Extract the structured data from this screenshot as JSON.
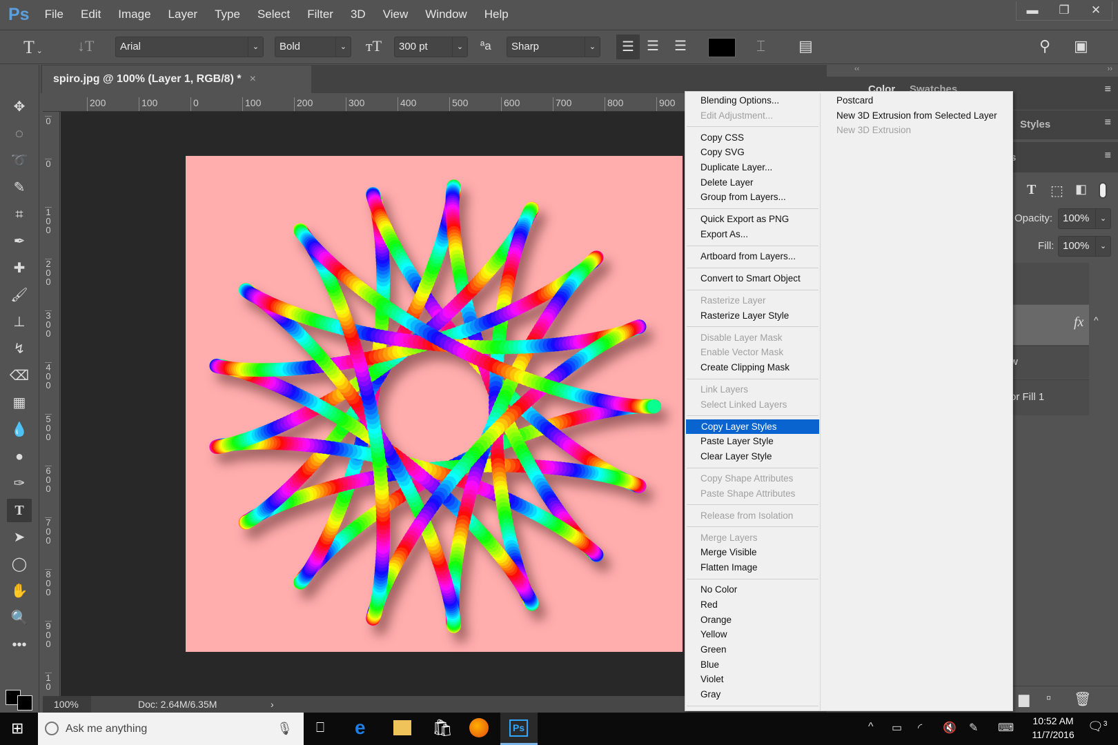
{
  "app": {
    "logo": "Ps",
    "menu": [
      "File",
      "Edit",
      "Image",
      "Layer",
      "Type",
      "Select",
      "Filter",
      "3D",
      "View",
      "Window",
      "Help"
    ],
    "window_controls": [
      "minimize",
      "restore",
      "close"
    ]
  },
  "options": {
    "font_family": "Arial",
    "font_style": "Bold",
    "font_size": "300 pt",
    "antialias": "Sharp",
    "text_color": "#000000"
  },
  "document": {
    "tab_title": "spiro.jpg @ 100% (Layer 1, RGB/8) *",
    "close": "×",
    "zoom": "100%",
    "doc_info": "Doc: 2.64M/6.35M",
    "canvas_color": "#ffadad"
  },
  "ruler": {
    "h": [
      "200",
      "100",
      "0",
      "100",
      "200",
      "300",
      "400",
      "500",
      "600",
      "700",
      "800",
      "900"
    ],
    "v": [
      "0",
      "0",
      "1 0 0",
      "2 0 0",
      "3 0 0",
      "4 0 0",
      "5 0 0",
      "6 0 0",
      "7 0 0",
      "8 0 0",
      "9 0 0",
      "1 0"
    ]
  },
  "tools": [
    "move",
    "marquee",
    "lasso",
    "quick-select",
    "crop",
    "eyedropper",
    "healing",
    "brush",
    "stamp",
    "history-brush",
    "eraser",
    "gradient",
    "blur",
    "dodge",
    "pen",
    "type",
    "path-select",
    "ellipse",
    "hand",
    "zoom",
    "more"
  ],
  "panels": {
    "tabs_top": [
      "Color",
      "Swatches"
    ],
    "styles_tab": "Styles",
    "layers_tab_partial": "s",
    "opacity_label": "Opacity:",
    "opacity": "100%",
    "fill_label": "Fill:",
    "fill": "100%",
    "fx": "fx",
    "layer_partial_1": "w",
    "layer_partial_2": "or Fill 1"
  },
  "context_menu": {
    "left": [
      {
        "label": "Blending Options..."
      },
      {
        "label": "Edit Adjustment...",
        "disabled": true
      },
      {
        "sep": true
      },
      {
        "label": "Copy CSS"
      },
      {
        "label": "Copy SVG"
      },
      {
        "label": "Duplicate Layer..."
      },
      {
        "label": "Delete Layer"
      },
      {
        "label": "Group from Layers..."
      },
      {
        "sep": true
      },
      {
        "label": "Quick Export as PNG"
      },
      {
        "label": "Export As..."
      },
      {
        "sep": true
      },
      {
        "label": "Artboard from Layers..."
      },
      {
        "sep": true
      },
      {
        "label": "Convert to Smart Object"
      },
      {
        "sep": true
      },
      {
        "label": "Rasterize Layer",
        "disabled": true
      },
      {
        "label": "Rasterize Layer Style"
      },
      {
        "sep": true
      },
      {
        "label": "Disable Layer Mask",
        "disabled": true
      },
      {
        "label": "Enable Vector Mask",
        "disabled": true
      },
      {
        "label": "Create Clipping Mask"
      },
      {
        "sep": true
      },
      {
        "label": "Link Layers",
        "disabled": true
      },
      {
        "label": "Select Linked Layers",
        "disabled": true
      },
      {
        "sep": true
      },
      {
        "label": "Copy Layer Styles",
        "selected": true
      },
      {
        "label": "Paste Layer Style"
      },
      {
        "label": "Clear Layer Style"
      },
      {
        "sep": true
      },
      {
        "label": "Copy Shape Attributes",
        "disabled": true
      },
      {
        "label": "Paste Shape Attributes",
        "disabled": true
      },
      {
        "sep": true
      },
      {
        "label": "Release from Isolation",
        "disabled": true
      },
      {
        "sep": true
      },
      {
        "label": "Merge Layers",
        "disabled": true
      },
      {
        "label": "Merge Visible"
      },
      {
        "label": "Flatten Image"
      },
      {
        "sep": true
      },
      {
        "label": "No Color"
      },
      {
        "label": "Red"
      },
      {
        "label": "Orange"
      },
      {
        "label": "Yellow"
      },
      {
        "label": "Green"
      },
      {
        "label": "Blue"
      },
      {
        "label": "Violet"
      },
      {
        "label": "Gray"
      },
      {
        "sep": true
      }
    ],
    "right": [
      {
        "label": "Postcard"
      },
      {
        "label": "New 3D Extrusion from Selected Layer"
      },
      {
        "label": "New 3D Extrusion",
        "disabled": true
      }
    ]
  },
  "taskbar": {
    "search_placeholder": "Ask me anything",
    "time": "10:52 AM",
    "date": "11/7/2016",
    "notifications": "3"
  }
}
